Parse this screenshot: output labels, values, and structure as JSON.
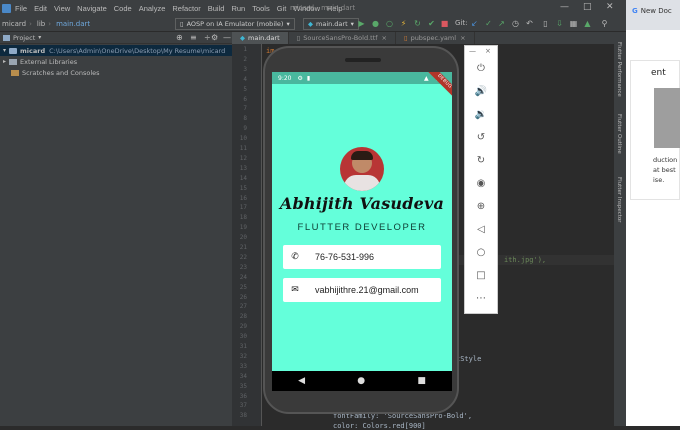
{
  "menubar": {
    "items": [
      "File",
      "Edit",
      "View",
      "Navigate",
      "Code",
      "Analyze",
      "Refactor",
      "Build",
      "Run",
      "Tools",
      "Git",
      "Window",
      "Help"
    ],
    "window_title": "micard - main.dart"
  },
  "toolbar": {
    "breadcrumb": [
      "micard",
      "lib",
      "main.dart"
    ],
    "device": "AOSP on IA Emulator (mobile)",
    "run_config": "main.dart",
    "git_label": "Git:"
  },
  "project": {
    "header": "Project",
    "root_name": "micard",
    "root_path": "C:\\Users\\Admin\\OneDrive\\Desktop\\My Resume\\micard",
    "items": [
      "External Libraries",
      "Scratches and Consoles"
    ]
  },
  "editor": {
    "tabs": [
      "main.dart",
      "SourceSansPro-Bold.ttf",
      "pubspec.yaml"
    ],
    "line_numbers": [
      "1",
      "2",
      "3",
      "4",
      "5",
      "6",
      "7",
      "8",
      "9",
      "10",
      "11",
      "12",
      "13",
      "14",
      "15",
      "16",
      "17",
      "18",
      "19",
      "20",
      "21",
      "22",
      "23",
      "24",
      "25",
      "26",
      "27",
      "28",
      "29",
      "30",
      "31",
      "32",
      "33",
      "34",
      "35",
      "36",
      "37",
      "38"
    ],
    "visible_code": {
      "l1": "im",
      "l20": "ith.jpg'),",
      "l29": "tStyle",
      "l37": "fontFamily: 'SourceSansPro-Bold',",
      "l38": "color: Colors.red[900]"
    }
  },
  "right_tabs": [
    "Flutter Performance",
    "Flutter Outline",
    "Flutter Inspector"
  ],
  "browser": {
    "tab_label": "New Doc",
    "partial_heading": "ent",
    "partial_text": [
      "duction",
      "at best",
      "ise."
    ]
  },
  "app": {
    "time": "9:20",
    "name": "Abhijith Vasudeva",
    "title": "FLUTTER DEVELOPER",
    "phone": "76-76-531-996",
    "email": "vabhijithre.21@gmail.com",
    "debug_banner": "DEBUG"
  },
  "emulator_panel": {
    "icons": [
      "power-icon",
      "volume-up-icon",
      "volume-down-icon",
      "rotate-left-icon",
      "rotate-right-icon",
      "camera-icon",
      "zoom-icon",
      "back-icon",
      "home-icon",
      "overview-icon",
      "more-icon"
    ]
  }
}
